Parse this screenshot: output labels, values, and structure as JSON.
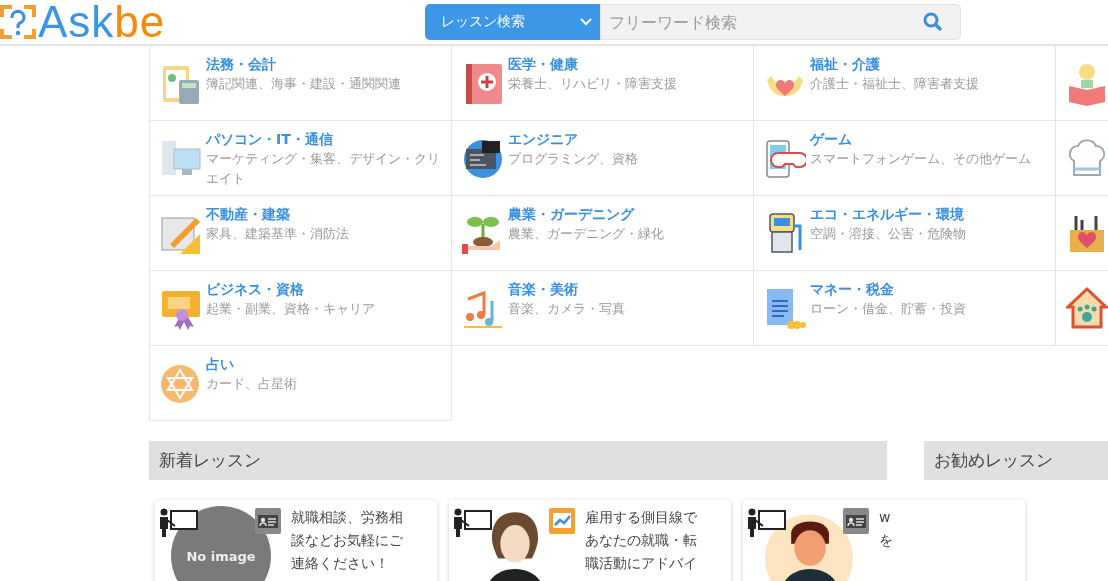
{
  "header": {
    "logo": [
      "Ask",
      "be"
    ],
    "search": {
      "category": "レッスン検索",
      "placeholder": "フリーワード検索"
    }
  },
  "categories": [
    {
      "kind": "calculator",
      "title": "法務・会計",
      "desc": "簿記関連、海事・建設・通関関連"
    },
    {
      "kind": "medical",
      "title": "医学・健康",
      "desc": "栄養士、リハビリ・障害支援"
    },
    {
      "kind": "hands",
      "title": "福祉・介護",
      "desc": "介護士・福祉士、障害者支援"
    },
    {
      "kind": "reader"
    },
    {
      "kind": "computer",
      "title": "パソコン・IT・通信",
      "desc": "マーケティング・集客、デザイン・クリエイト"
    },
    {
      "kind": "code",
      "title": "エンジニア",
      "desc": "プログラミング、資格"
    },
    {
      "kind": "game",
      "title": "ゲーム",
      "desc": "スマートフォンゲーム、その他ゲーム"
    },
    {
      "kind": "chef"
    },
    {
      "kind": "drafting",
      "title": "不動産・建築",
      "desc": "家具、建築基準・消防法"
    },
    {
      "kind": "plant",
      "title": "農業・ガーデニング",
      "desc": "農業、ガーデニング・緑化"
    },
    {
      "kind": "station",
      "title": "エコ・エネルギー・環境",
      "desc": "空調・溶接、公害・危険物"
    },
    {
      "kind": "craft"
    },
    {
      "kind": "certificate",
      "title": "ビジネス・資格",
      "desc": "起業・副業、資格・キャリア"
    },
    {
      "kind": "music",
      "title": "音楽・美術",
      "desc": "音楽、カメラ・写真"
    },
    {
      "kind": "money",
      "title": "マネー・税金",
      "desc": "ローン・借金、貯蓄・投資"
    },
    {
      "kind": "pethouse"
    },
    {
      "kind": "star",
      "title": "占い",
      "desc": "カード、占星術"
    }
  ],
  "sections": [
    {
      "title": "新着レッスン"
    },
    {
      "title": "お勧めレッスン"
    }
  ],
  "lessons": [
    {
      "avatar": {
        "kind": "none",
        "text": "No image"
      },
      "badge": {
        "kind": "id"
      },
      "lines": [
        "就職相談、労務相",
        "談などお気軽にご",
        "連絡ください！"
      ]
    },
    {
      "avatar": {
        "kind": "man"
      },
      "badge": {
        "kind": "chart"
      },
      "lines": [
        "雇用する側目線で",
        "あなたの就職・転",
        "職活動にアドバイ"
      ]
    },
    {
      "avatar": {
        "kind": "boy"
      },
      "badge": {
        "kind": "id"
      },
      "lines": [
        "w",
        "を"
      ]
    }
  ]
}
